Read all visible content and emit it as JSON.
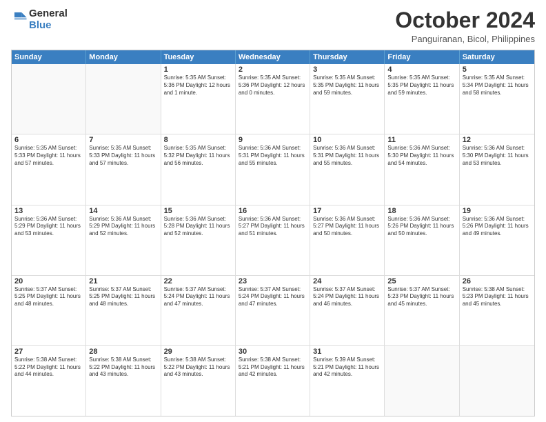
{
  "header": {
    "logo_line1": "General",
    "logo_line2": "Blue",
    "month": "October 2024",
    "location": "Panguiranan, Bicol, Philippines"
  },
  "weekdays": [
    "Sunday",
    "Monday",
    "Tuesday",
    "Wednesday",
    "Thursday",
    "Friday",
    "Saturday"
  ],
  "rows": [
    [
      {
        "day": "",
        "info": ""
      },
      {
        "day": "",
        "info": ""
      },
      {
        "day": "1",
        "info": "Sunrise: 5:35 AM\nSunset: 5:36 PM\nDaylight: 12 hours\nand 1 minute."
      },
      {
        "day": "2",
        "info": "Sunrise: 5:35 AM\nSunset: 5:36 PM\nDaylight: 12 hours\nand 0 minutes."
      },
      {
        "day": "3",
        "info": "Sunrise: 5:35 AM\nSunset: 5:35 PM\nDaylight: 11 hours\nand 59 minutes."
      },
      {
        "day": "4",
        "info": "Sunrise: 5:35 AM\nSunset: 5:35 PM\nDaylight: 11 hours\nand 59 minutes."
      },
      {
        "day": "5",
        "info": "Sunrise: 5:35 AM\nSunset: 5:34 PM\nDaylight: 11 hours\nand 58 minutes."
      }
    ],
    [
      {
        "day": "6",
        "info": "Sunrise: 5:35 AM\nSunset: 5:33 PM\nDaylight: 11 hours\nand 57 minutes."
      },
      {
        "day": "7",
        "info": "Sunrise: 5:35 AM\nSunset: 5:33 PM\nDaylight: 11 hours\nand 57 minutes."
      },
      {
        "day": "8",
        "info": "Sunrise: 5:35 AM\nSunset: 5:32 PM\nDaylight: 11 hours\nand 56 minutes."
      },
      {
        "day": "9",
        "info": "Sunrise: 5:36 AM\nSunset: 5:31 PM\nDaylight: 11 hours\nand 55 minutes."
      },
      {
        "day": "10",
        "info": "Sunrise: 5:36 AM\nSunset: 5:31 PM\nDaylight: 11 hours\nand 55 minutes."
      },
      {
        "day": "11",
        "info": "Sunrise: 5:36 AM\nSunset: 5:30 PM\nDaylight: 11 hours\nand 54 minutes."
      },
      {
        "day": "12",
        "info": "Sunrise: 5:36 AM\nSunset: 5:30 PM\nDaylight: 11 hours\nand 53 minutes."
      }
    ],
    [
      {
        "day": "13",
        "info": "Sunrise: 5:36 AM\nSunset: 5:29 PM\nDaylight: 11 hours\nand 53 minutes."
      },
      {
        "day": "14",
        "info": "Sunrise: 5:36 AM\nSunset: 5:29 PM\nDaylight: 11 hours\nand 52 minutes."
      },
      {
        "day": "15",
        "info": "Sunrise: 5:36 AM\nSunset: 5:28 PM\nDaylight: 11 hours\nand 52 minutes."
      },
      {
        "day": "16",
        "info": "Sunrise: 5:36 AM\nSunset: 5:27 PM\nDaylight: 11 hours\nand 51 minutes."
      },
      {
        "day": "17",
        "info": "Sunrise: 5:36 AM\nSunset: 5:27 PM\nDaylight: 11 hours\nand 50 minutes."
      },
      {
        "day": "18",
        "info": "Sunrise: 5:36 AM\nSunset: 5:26 PM\nDaylight: 11 hours\nand 50 minutes."
      },
      {
        "day": "19",
        "info": "Sunrise: 5:36 AM\nSunset: 5:26 PM\nDaylight: 11 hours\nand 49 minutes."
      }
    ],
    [
      {
        "day": "20",
        "info": "Sunrise: 5:37 AM\nSunset: 5:25 PM\nDaylight: 11 hours\nand 48 minutes."
      },
      {
        "day": "21",
        "info": "Sunrise: 5:37 AM\nSunset: 5:25 PM\nDaylight: 11 hours\nand 48 minutes."
      },
      {
        "day": "22",
        "info": "Sunrise: 5:37 AM\nSunset: 5:24 PM\nDaylight: 11 hours\nand 47 minutes."
      },
      {
        "day": "23",
        "info": "Sunrise: 5:37 AM\nSunset: 5:24 PM\nDaylight: 11 hours\nand 47 minutes."
      },
      {
        "day": "24",
        "info": "Sunrise: 5:37 AM\nSunset: 5:24 PM\nDaylight: 11 hours\nand 46 minutes."
      },
      {
        "day": "25",
        "info": "Sunrise: 5:37 AM\nSunset: 5:23 PM\nDaylight: 11 hours\nand 45 minutes."
      },
      {
        "day": "26",
        "info": "Sunrise: 5:38 AM\nSunset: 5:23 PM\nDaylight: 11 hours\nand 45 minutes."
      }
    ],
    [
      {
        "day": "27",
        "info": "Sunrise: 5:38 AM\nSunset: 5:22 PM\nDaylight: 11 hours\nand 44 minutes."
      },
      {
        "day": "28",
        "info": "Sunrise: 5:38 AM\nSunset: 5:22 PM\nDaylight: 11 hours\nand 43 minutes."
      },
      {
        "day": "29",
        "info": "Sunrise: 5:38 AM\nSunset: 5:22 PM\nDaylight: 11 hours\nand 43 minutes."
      },
      {
        "day": "30",
        "info": "Sunrise: 5:38 AM\nSunset: 5:21 PM\nDaylight: 11 hours\nand 42 minutes."
      },
      {
        "day": "31",
        "info": "Sunrise: 5:39 AM\nSunset: 5:21 PM\nDaylight: 11 hours\nand 42 minutes."
      },
      {
        "day": "",
        "info": ""
      },
      {
        "day": "",
        "info": ""
      }
    ]
  ]
}
